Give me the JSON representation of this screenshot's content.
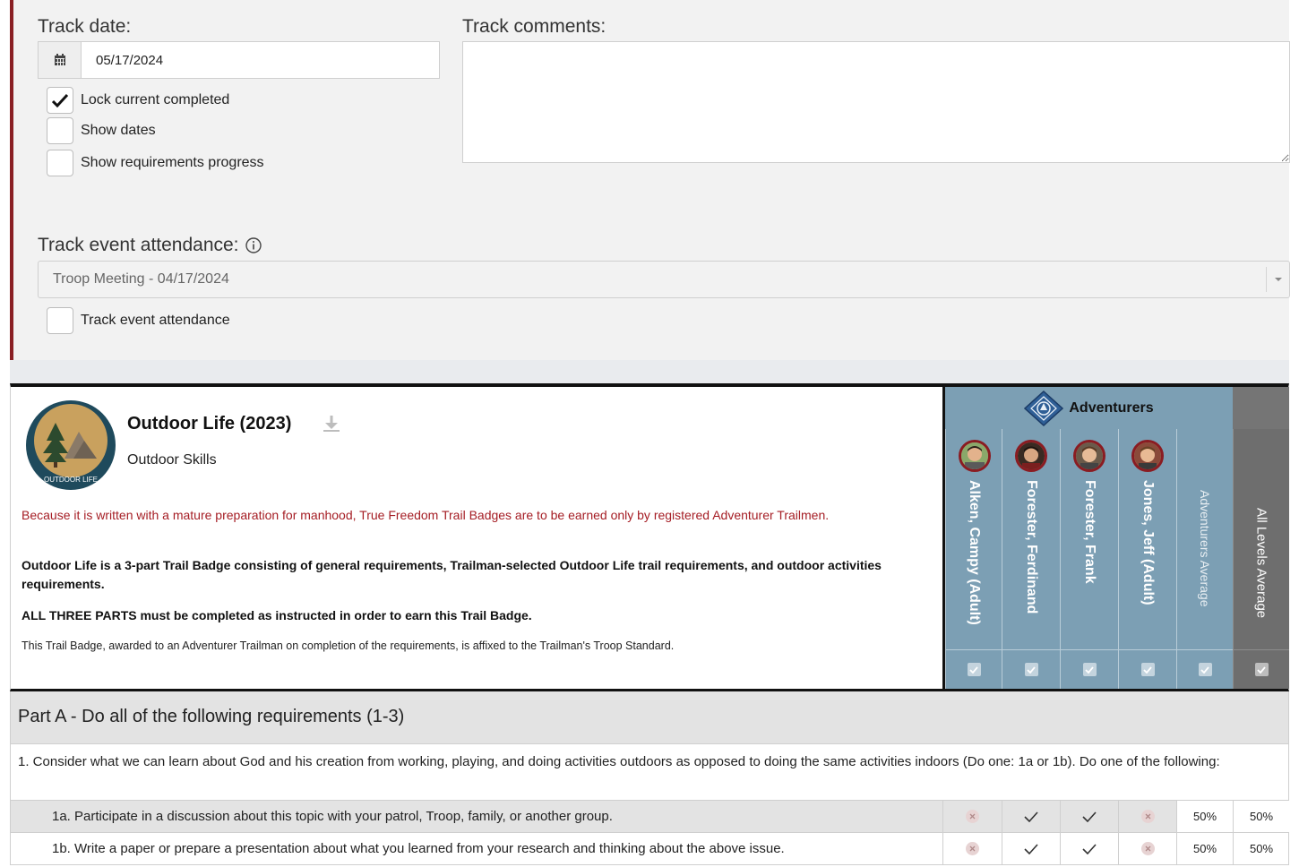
{
  "form": {
    "track_date_label": "Track date:",
    "track_date_value": "05/17/2024",
    "track_comments_label": "Track comments:",
    "track_comments_value": "",
    "checkboxes": [
      {
        "label": "Lock current completed",
        "checked": true
      },
      {
        "label": "Show dates",
        "checked": false
      },
      {
        "label": "Show requirements progress",
        "checked": false
      }
    ],
    "event_attendance_label": "Track event attendance:",
    "event_select_value": "Troop Meeting - 04/17/2024",
    "track_event_attendance_checkbox": {
      "label": "Track event attendance",
      "checked": false
    }
  },
  "badge": {
    "title": "Outdoor Life (2023)",
    "category": "Outdoor Skills",
    "logo_text": "OUTDOOR LIFE",
    "warning": "Because it is written with a mature preparation for manhood, True Freedom Trail Badges are to be earned only by registered Adventurer Trailmen.",
    "overview": "Outdoor Life is a 3-part Trail Badge consisting of general requirements, Trailman-selected Outdoor Life trail requirements, and outdoor activities requirements.",
    "parts_note": "ALL THREE PARTS must be completed as instructed in order to earn this Trail Badge.",
    "award_note": "This Trail Badge, awarded to an Adventurer Trailman on completion of the requirements, is affixed to the Trailman's Troop Standard."
  },
  "grid": {
    "group_name": "Adventurers",
    "members": [
      {
        "name": "Alken, Campy (Adult)"
      },
      {
        "name": "Forester, Ferdinand"
      },
      {
        "name": "Forester, Frank"
      },
      {
        "name": "Jones, Jeff (Adult)"
      }
    ],
    "group_average_label": "Adventurers Average",
    "all_average_label": "All Levels Average"
  },
  "requirements": {
    "part_label": "Part A -",
    "part_title": " Do all of the following requirements (1-3)",
    "req1_text": "1.  Consider what we can learn about God and his creation from working, playing, and doing activities outdoors as opposed to doing the same activities indoors (Do one: 1a or 1b). Do one of the following:",
    "subs": [
      {
        "text": "1a.  Participate in a discussion about this topic with your patrol, Troop, family, or another group.",
        "status": [
          "incomplete",
          "complete",
          "complete",
          "incomplete"
        ],
        "group_avg": "50%",
        "all_avg": "50%"
      },
      {
        "text": "1b.  Write a paper or prepare a presentation about what you learned from your research and thinking about the above issue.",
        "status": [
          "incomplete",
          "complete",
          "complete",
          "incomplete"
        ],
        "group_avg": "50%",
        "all_avg": "50%"
      }
    ]
  },
  "colors": {
    "accent_red": "#8a1f24",
    "group_blue": "#7c9fb4",
    "all_gray": "#6e6e6e",
    "warning_red": "#a51d24"
  },
  "icons": [
    "calendar-icon",
    "checkmark-icon",
    "info-icon",
    "caret-down-icon",
    "download-icon",
    "group-emblem-icon",
    "avatar",
    "check-icon",
    "x-icon"
  ]
}
